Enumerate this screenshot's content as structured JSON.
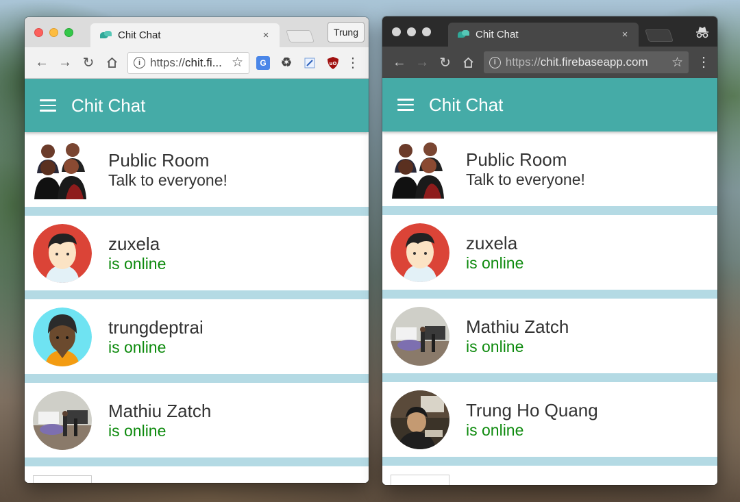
{
  "windows": {
    "left": {
      "tab_title": "Chit Chat",
      "tab_close": "×",
      "profile_name": "Trung",
      "url_scheme": "https://",
      "url_host": "chit.fi...",
      "app_title": "Chit Chat",
      "rooms": [
        {
          "name": "Public Room",
          "sub": "Talk to everyone!",
          "avatar": "group-people-icon",
          "online": false
        },
        {
          "name": "zuxela",
          "sub": "is online",
          "avatar": "avatar-red-boy",
          "online": true
        },
        {
          "name": "trungdeptrai",
          "sub": "is online",
          "avatar": "avatar-cyan-boy",
          "online": true
        },
        {
          "name": "Mathiu Zatch",
          "sub": "is online",
          "avatar": "photo-avatar",
          "online": true
        }
      ]
    },
    "right": {
      "tab_title": "Chit Chat",
      "tab_close": "×",
      "url_scheme": "https://",
      "url_host": "chit.firebaseapp.com",
      "app_title": "Chit Chat",
      "rooms": [
        {
          "name": "Public Room",
          "sub": "Talk to everyone!",
          "avatar": "group-people-icon",
          "online": false
        },
        {
          "name": "zuxela",
          "sub": "is online",
          "avatar": "avatar-red-boy",
          "online": true
        },
        {
          "name": "Mathiu Zatch",
          "sub": "is online",
          "avatar": "photo-avatar",
          "online": true
        },
        {
          "name": "Trung Ho Quang",
          "sub": "is online",
          "avatar": "photo-avatar",
          "online": true
        }
      ]
    }
  },
  "colors": {
    "header": "#45aba7",
    "online": "#0d8a0d",
    "list_gap": "#b4dae4"
  }
}
